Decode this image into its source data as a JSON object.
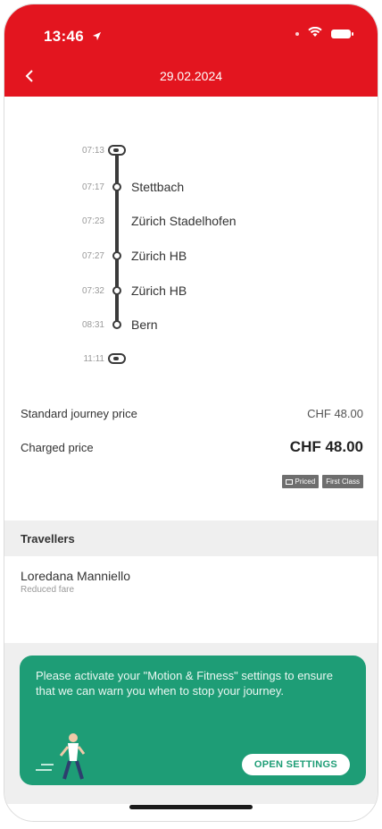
{
  "status_bar": {
    "time": "13:46"
  },
  "nav": {
    "title": "29.02.2024"
  },
  "timeline": {
    "start_time": "07:13",
    "stops": [
      {
        "time": "07:17",
        "name": "Stettbach"
      },
      {
        "time": "07:23",
        "name": "Zürich Stadelhofen"
      },
      {
        "time": "07:27",
        "name": "Zürich HB"
      },
      {
        "time": "07:32",
        "name": "Zürich HB"
      },
      {
        "time": "08:31",
        "name": "Bern"
      }
    ],
    "end_time": "11:11"
  },
  "prices": {
    "standard_label": "Standard journey price",
    "standard_value": "CHF 48.00",
    "charged_label": "Charged price",
    "charged_value": "CHF 48.00",
    "tags": [
      "Priced",
      "First Class"
    ]
  },
  "travellers": {
    "title": "Travellers",
    "items": [
      {
        "name": "Loredana Manniello",
        "fare": "Reduced fare"
      }
    ]
  },
  "banner": {
    "text": "Please activate your \"Motion & Fitness\" settings to ensure that we can warn you when to stop your journey.",
    "button_label": "OPEN SETTINGS"
  },
  "colors": {
    "brand_red": "#e3151f",
    "banner_green": "#1e9d76"
  }
}
